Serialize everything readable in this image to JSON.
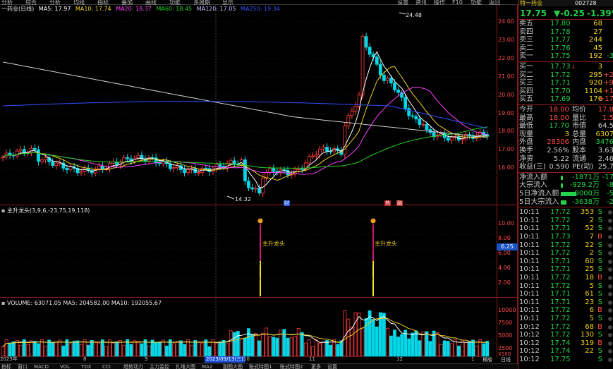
{
  "top_menu": {
    "left_items": [
      "分析",
      "综合",
      "分析",
      "均线",
      "指标",
      "叠加",
      "画线",
      "功能",
      "多周期",
      "显示"
    ],
    "right_items": [
      "设置",
      "资讯",
      "操作",
      "F10",
      "功能",
      "返回"
    ]
  },
  "ma_legend": {
    "stock_name": "一药业(日线)",
    "ma5": "MA5: 17.97",
    "ma10": "MA10: 17.74",
    "ma20": "MA20: 18.37",
    "ma60": "MA60: 18.45",
    "ma120": "MA120: 17.05",
    "ma250": "MA250: 19.34"
  },
  "colors": {
    "up": "#ff3c3c",
    "down": "#00d8e8",
    "ma5": "#ffffff",
    "ma10": "#f0d020",
    "ma20": "#ff40ff",
    "ma60": "#20d020",
    "ma120": "#3050ff",
    "ma250": "#d0d0d0"
  },
  "price_chart": {
    "high_label": "24.48",
    "low_label": "14.32",
    "y_ticks": [
      "24.00",
      "23.00",
      "22.00",
      "21.00",
      "20.00",
      "19.00",
      "18.00",
      "17.00",
      "16.00"
    ],
    "markers": [
      "财",
      "热",
      "融"
    ]
  },
  "indicator": {
    "title": "主升龙头(3,9,6,-23,75,19,118)",
    "signal_label": "主升龙头",
    "signal_label_2": "主升龙头",
    "y_ticks": [
      "10.00",
      "8.00",
      "6.00",
      "4.00",
      "2.00"
    ],
    "current_value": "6.25"
  },
  "volume": {
    "legend": "VOLUME: 63071.05  MA5: 204582.00  MA10: 192055.67",
    "y_ticks": [
      "10000",
      "7500",
      "5000",
      "2500"
    ],
    "unit": "X100"
  },
  "x_axis": {
    "labels": [
      "2023年",
      "8",
      "9",
      "2023/09/13(三)",
      "10",
      "11",
      "12",
      "1"
    ]
  },
  "bottom_tabs": [
    "指标",
    "窗口",
    "MACD",
    "VOL",
    "TDX",
    "CCI",
    "趋势动力",
    "主力监控",
    "扎堆大图",
    "MA2",
    "副图大图",
    "账式特图1",
    "账式特图2",
    "更多",
    "设置"
  ],
  "right_bottom_tabs": [
    "横版",
    "日线"
  ],
  "quote": {
    "code": "002728",
    "name_fragment": "特一药业",
    "price": "17.75",
    "change": "▼-0.25",
    "change_pct": "-1.39%",
    "asks": [
      {
        "label": "卖五",
        "price": "17.80",
        "vol": "68",
        "mark": ""
      },
      {
        "label": "卖四",
        "price": "17.78",
        "vol": "27",
        "mark": ""
      },
      {
        "label": "卖三",
        "price": "17.77",
        "vol": "244",
        "mark": ""
      },
      {
        "label": "卖二",
        "price": "17.76",
        "vol": "45",
        "mark": ""
      },
      {
        "label": "卖一",
        "price": "17.75",
        "vol": "192",
        "mark": "-3"
      }
    ],
    "bids": [
      {
        "label": "买一",
        "price": "17.73",
        "flag": "↓",
        "vol": "3",
        "mark": ""
      },
      {
        "label": "买二",
        "price": "17.72",
        "flag": "",
        "vol": "295",
        "mark": "+2"
      },
      {
        "label": "买三",
        "price": "17.71",
        "flag": "",
        "vol": "920",
        "mark": "+9"
      },
      {
        "label": "买四",
        "price": "17.70",
        "flag": "",
        "vol": "1104",
        "mark": "+1"
      },
      {
        "label": "买五",
        "price": "17.69",
        "flag": "",
        "vol": "176",
        "mark": "+17"
      }
    ],
    "stats": [
      {
        "l1": "今开",
        "v1": "18.00",
        "l2": "均价",
        "v2": "17.8"
      },
      {
        "l1": "最高",
        "v1": "18.00",
        "l2": "量比",
        "v2": "1.5"
      },
      {
        "l1": "最低",
        "v1": "17.70",
        "l2": "市值",
        "v2": "64.5"
      },
      {
        "l1": "现量",
        "v1": "3",
        "l2": "总量",
        "v2": "6307"
      },
      {
        "l1": "外盘",
        "v1": "28306",
        "l2": "内盘",
        "v2": "3476"
      },
      {
        "l1": "换手",
        "v1": "2.56%",
        "l2": "股本",
        "v2": "3.63"
      },
      {
        "l1": "净资",
        "v1": "5.22",
        "l2": "流通",
        "v2": "2.46"
      },
      {
        "l1": "收益(三)",
        "v1": "0.590",
        "l2": "PE(动)",
        "v2": "25.7"
      }
    ],
    "flows": [
      {
        "label": "净流入额",
        "value": "-1871万",
        "pct": "-17"
      },
      {
        "label": "大宗流入",
        "value": "-929.2万",
        "pct": "-8"
      },
      {
        "label": "5日净流入额",
        "value": "-9000万",
        "pct": "-5"
      },
      {
        "label": "5日大宗流入",
        "value": "-3638万",
        "pct": "-2"
      }
    ],
    "ticks": [
      {
        "t": "10:11",
        "p": "17.72",
        "v": "353",
        "d": "S",
        "c": "green"
      },
      {
        "t": "10:11",
        "p": "17.72",
        "v": "2",
        "d": "S",
        "c": "green"
      },
      {
        "t": "10:11",
        "p": "17.71",
        "v": "52",
        "d": "S",
        "c": "green"
      },
      {
        "t": "10:11",
        "p": "17.73",
        "v": "7",
        "d": "B",
        "c": "red"
      },
      {
        "t": "10:11",
        "p": "17.72",
        "v": "22",
        "d": "S",
        "c": "green"
      },
      {
        "t": "10:11",
        "p": "17.72",
        "v": "2",
        "d": "S",
        "c": "green"
      },
      {
        "t": "10:11",
        "p": "17.71",
        "v": "60",
        "d": "S",
        "c": "green"
      },
      {
        "t": "10:11",
        "p": "17.71",
        "v": "25",
        "d": "S",
        "c": "green"
      },
      {
        "t": "10:11",
        "p": "17.72",
        "v": "18",
        "d": "B",
        "c": "red"
      },
      {
        "t": "10:11",
        "p": "17.72",
        "v": "5",
        "d": "S",
        "c": "green"
      },
      {
        "t": "10:11",
        "p": "17.71",
        "v": "61",
        "d": "S",
        "c": "green"
      },
      {
        "t": "10:11",
        "p": "17.71",
        "v": "23",
        "d": "S",
        "c": "green"
      },
      {
        "t": "10:11",
        "p": "17.72",
        "v": "6",
        "d": "B",
        "c": "red"
      },
      {
        "t": "10:11",
        "p": "17.72",
        "v": "5",
        "d": "S",
        "c": "green"
      },
      {
        "t": "10:12",
        "p": "17.72",
        "v": "68",
        "d": "B",
        "c": "red"
      },
      {
        "t": "10:12",
        "p": "17.72",
        "v": "130",
        "d": "S",
        "c": "green"
      },
      {
        "t": "10:12",
        "p": "17.74",
        "v": "319",
        "d": "B",
        "c": "red"
      },
      {
        "t": "10:12",
        "p": "17.74",
        "v": "22",
        "d": "S",
        "c": "green"
      },
      {
        "t": "10:12",
        "p": "17.75",
        "v": "",
        "d": "S",
        "c": "green"
      }
    ]
  }
}
